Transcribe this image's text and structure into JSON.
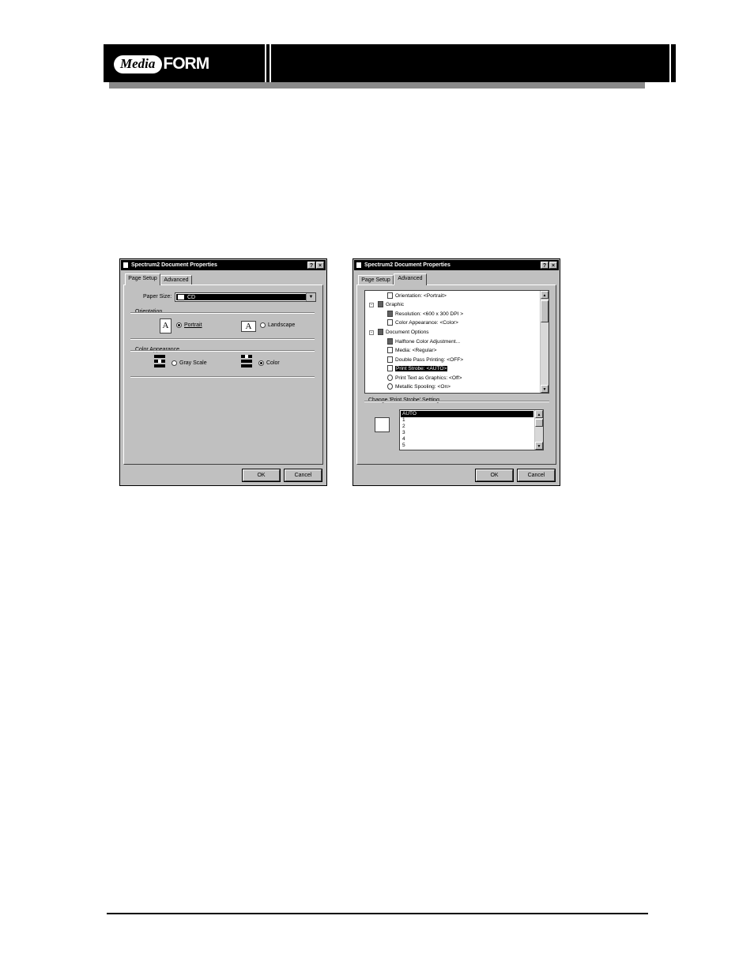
{
  "header": {
    "logo_media": "Media",
    "logo_form": "FORM"
  },
  "dialogs": [
    {
      "title": "Spectrum2 Document Properties",
      "help_label": "?",
      "close_label": "×",
      "tabs": [
        {
          "label": "Page Setup",
          "active": true
        },
        {
          "label": "Advanced",
          "active": false
        }
      ],
      "paper_size_label": "Paper Size:",
      "paper_size_value": "CD",
      "orientation_label": "Orientation",
      "portrait_label": "Portrait",
      "landscape_label": "Landscape",
      "orientation_selected": "Portrait",
      "color_appearance_label": "Color Appearance",
      "gray_scale_label": "Gray Scale",
      "color_label": "Color",
      "color_selected": "Color",
      "page_icon_glyph": "A",
      "ok_label": "OK",
      "cancel_label": "Cancel"
    },
    {
      "title": "Spectrum2 Document Properties",
      "help_label": "?",
      "close_label": "×",
      "tabs": [
        {
          "label": "Page Setup",
          "active": false
        },
        {
          "label": "Advanced",
          "active": true
        }
      ],
      "tree_items": [
        {
          "text": "Orientation: <Portrait>",
          "icon": "page-icon"
        },
        {
          "text": "Graphic",
          "icon": "graphic-icon",
          "expander": "-"
        },
        {
          "text": "Resolution: <600 x 300 DPI >",
          "icon": "resolution-icon"
        },
        {
          "text": "Color Appearance: <Color>",
          "icon": "color-icon"
        },
        {
          "text": "Document Options",
          "icon": "options-icon",
          "expander": "-"
        },
        {
          "text": "Halftone Color Adjustment...",
          "icon": "halftone-icon"
        },
        {
          "text": "Media: <Regular>",
          "icon": "media-icon"
        },
        {
          "text": "Double Pass Printing: <OFF>",
          "icon": "checkbox-icon"
        },
        {
          "text": "Print Strobe: <AUTO>",
          "icon": "checkbox-icon",
          "selected": true
        },
        {
          "text": "Print Text as Graphics: <Off>",
          "icon": "bulb-icon"
        },
        {
          "text": "Metallic Spooling: <On>",
          "icon": "bulb-icon"
        }
      ],
      "change_setting_label": "Change 'Print Strobe' Setting",
      "strobe_options": [
        "AUTO",
        "1",
        "2",
        "3",
        "4",
        "5"
      ],
      "strobe_selected": "AUTO",
      "ok_label": "OK",
      "cancel_label": "Cancel"
    }
  ]
}
